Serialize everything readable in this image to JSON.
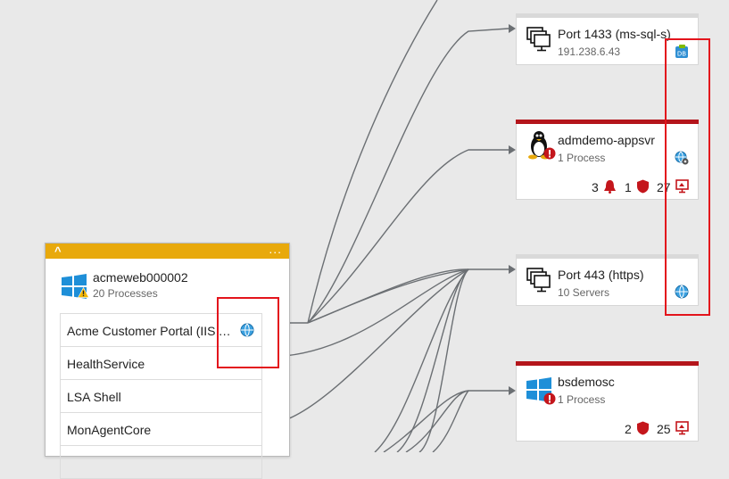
{
  "nodes": {
    "port_1433": {
      "title": "Port 1433 (ms-sql-s)",
      "subtitle": "191.238.6.43",
      "badge_icon": "sql-database-icon"
    },
    "admdemo": {
      "title": "admdemo-appsvr",
      "subtitle": "1 Process",
      "os_icon": "linux-tux-icon",
      "alert": true,
      "stats": {
        "alerts": "3",
        "security": "1",
        "updates": "27"
      }
    },
    "port_443": {
      "title": "Port 443 (https)",
      "subtitle": "10 Servers",
      "badge_icon": "globe-icon"
    },
    "bsdemosc": {
      "title": "bsdemosc",
      "subtitle": "1 Process",
      "os_icon": "windows-logo-icon",
      "alert": true,
      "stats": {
        "security": "2",
        "updates": "25"
      }
    }
  },
  "machine": {
    "header_collapse": "^",
    "header_more": "...",
    "name": "acmeweb000002",
    "processes_count": "20 Processes",
    "processes": [
      {
        "label": "Acme Customer Portal (IIS App Pool)"
      },
      {
        "label": "HealthService"
      },
      {
        "label": "LSA Shell"
      },
      {
        "label": "MonAgentCore"
      }
    ]
  },
  "colors": {
    "alert_red": "#b4151b",
    "header_amber": "#e8a90c",
    "highlight_red": "#e3141c",
    "link_gray": "#6b6f73"
  }
}
